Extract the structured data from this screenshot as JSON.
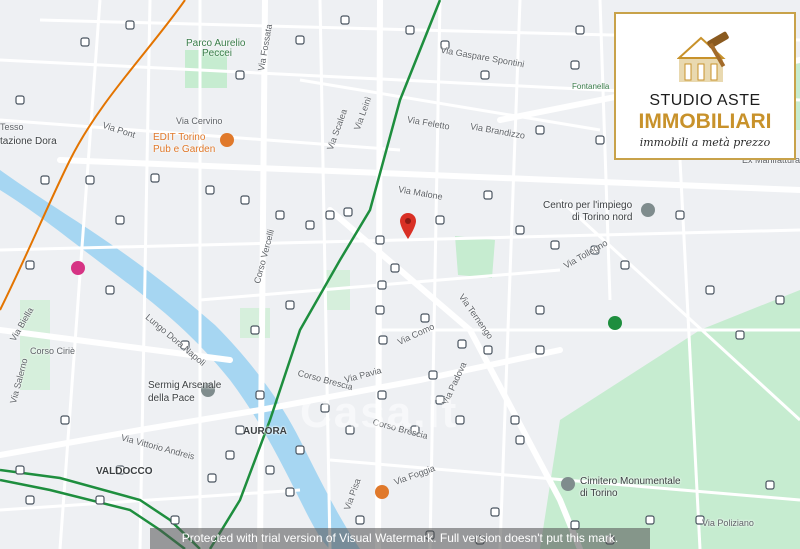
{
  "colors": {
    "water": "#a6d6f2",
    "park": "#c6ecd0",
    "road": "#ffffff",
    "tram": "#1e8e3e",
    "rail": "#e37400",
    "brand_gold": "#c8922b"
  },
  "labels": {
    "parco": "Parco Aurelio",
    "peccei": "Peccei",
    "via_fossata": "Via Fossata",
    "via_gaspare": "Via Gaspare Spontini",
    "fontanella": "Fontanella",
    "tesso": "Tesso",
    "stazione": "tazione Dora",
    "via_pont": "Via Pont",
    "via_cervino": "Via Cervino",
    "edit1": "EDIT Torino",
    "edit2": "Pub e Garden",
    "via_scalea": "Via Scalea",
    "via_leini": "Via Leinì",
    "via_feletto": "Via Feletto",
    "via_brandizzo": "Via Brandizzo",
    "ex_manif": "Ex Manifattura",
    "via_malone": "Via Malone",
    "centro1": "Centro per l'impiego",
    "centro2": "di Torino nord",
    "corso_vercelli": "Corso Vercelli",
    "via_tollegno": "Via Tollegno",
    "via_ternengo": "Via Ternengo",
    "lungo_dora": "Lungo Dora Napoli",
    "via_biella": "Via Biella",
    "corso_cirie": "Corso Ciriè",
    "via_como": "Via Como",
    "sermig1": "Sermig Arsenale",
    "sermig2": "della Pace",
    "via_salerno": "Via Salerno",
    "via_pavia": "Via Pavia",
    "corso_brescia1": "Corso Brescia",
    "corso_brescia2": "Corso Brescia",
    "via_padova": "Via Padova",
    "aurora": "AURORA",
    "valdocco": "VALDOCCO",
    "via_vittorio": "Via Vittorio Andreis",
    "via_pisa": "Via Pisa",
    "via_foggia": "Via Foggia",
    "cimitero1": "Cimitero Monumentale",
    "cimitero2": "di Torino",
    "via_poliziano": "Via Poliziano"
  },
  "logo": {
    "line1": "STUDIO ASTE",
    "line2": "IMMOBILIARI",
    "line3": "immobili a metà prezzo"
  },
  "watermark": {
    "big_text": "Casa.it",
    "bar_text": "Protected with trial version of Visual Watermark. Full version doesn't put this mark."
  }
}
